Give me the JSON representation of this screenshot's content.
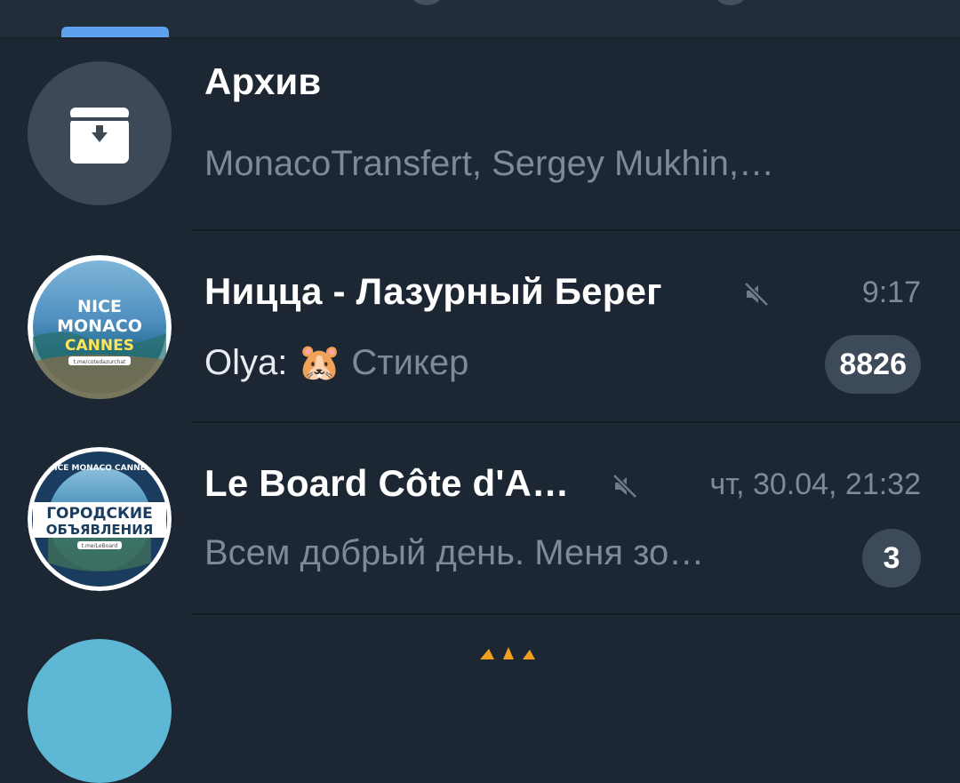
{
  "chats": [
    {
      "title": "Архив",
      "preview": "MonacoTransfert, Sergey Mukhin,…",
      "avatar_icon": "archive-box-icon"
    },
    {
      "title": "Ницца - Лазурный Берег",
      "sender": "Olya:",
      "preview_emoji": "🐹",
      "preview": "Стикер",
      "time": "9:17",
      "unread": "8826",
      "muted": true,
      "avatar_text": [
        "NICE",
        "MONACO",
        "CANNES",
        "t.me/cotedazurchat"
      ]
    },
    {
      "title": "Le Board Côte d'A…",
      "preview": "Всем добрый день. Меня зо…",
      "time": "чт, 30.04, 21:32",
      "unread": "3",
      "muted": true,
      "avatar_text": [
        "NICE MONACO CANNES",
        "ГОРОДСКИЕ",
        "ОБЪЯВЛЕНИЯ",
        "t.me/LeBoard"
      ]
    }
  ],
  "colors": {
    "background": "#1d2733",
    "accent": "#5ea2ef",
    "badge": "#3d4a59",
    "muted_text": "#7c8a99"
  }
}
